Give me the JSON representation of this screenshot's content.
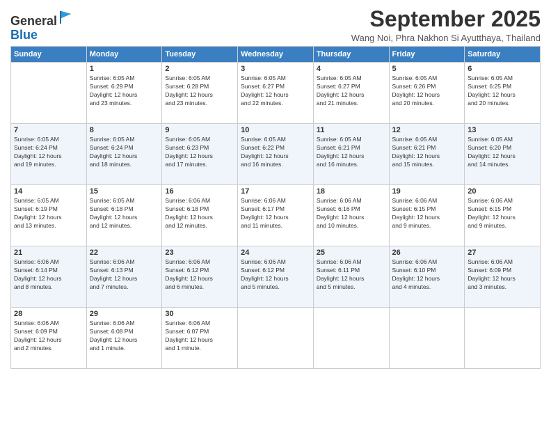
{
  "header": {
    "logo_line1": "General",
    "logo_line2": "Blue",
    "month_title": "September 2025",
    "location": "Wang Noi, Phra Nakhon Si Ayutthaya, Thailand"
  },
  "weekdays": [
    "Sunday",
    "Monday",
    "Tuesday",
    "Wednesday",
    "Thursday",
    "Friday",
    "Saturday"
  ],
  "weeks": [
    [
      {
        "day": "",
        "info": ""
      },
      {
        "day": "1",
        "info": "Sunrise: 6:05 AM\nSunset: 6:29 PM\nDaylight: 12 hours\nand 23 minutes."
      },
      {
        "day": "2",
        "info": "Sunrise: 6:05 AM\nSunset: 6:28 PM\nDaylight: 12 hours\nand 23 minutes."
      },
      {
        "day": "3",
        "info": "Sunrise: 6:05 AM\nSunset: 6:27 PM\nDaylight: 12 hours\nand 22 minutes."
      },
      {
        "day": "4",
        "info": "Sunrise: 6:05 AM\nSunset: 6:27 PM\nDaylight: 12 hours\nand 21 minutes."
      },
      {
        "day": "5",
        "info": "Sunrise: 6:05 AM\nSunset: 6:26 PM\nDaylight: 12 hours\nand 20 minutes."
      },
      {
        "day": "6",
        "info": "Sunrise: 6:05 AM\nSunset: 6:25 PM\nDaylight: 12 hours\nand 20 minutes."
      }
    ],
    [
      {
        "day": "7",
        "info": "Sunrise: 6:05 AM\nSunset: 6:24 PM\nDaylight: 12 hours\nand 19 minutes."
      },
      {
        "day": "8",
        "info": "Sunrise: 6:05 AM\nSunset: 6:24 PM\nDaylight: 12 hours\nand 18 minutes."
      },
      {
        "day": "9",
        "info": "Sunrise: 6:05 AM\nSunset: 6:23 PM\nDaylight: 12 hours\nand 17 minutes."
      },
      {
        "day": "10",
        "info": "Sunrise: 6:05 AM\nSunset: 6:22 PM\nDaylight: 12 hours\nand 16 minutes."
      },
      {
        "day": "11",
        "info": "Sunrise: 6:05 AM\nSunset: 6:21 PM\nDaylight: 12 hours\nand 16 minutes."
      },
      {
        "day": "12",
        "info": "Sunrise: 6:05 AM\nSunset: 6:21 PM\nDaylight: 12 hours\nand 15 minutes."
      },
      {
        "day": "13",
        "info": "Sunrise: 6:05 AM\nSunset: 6:20 PM\nDaylight: 12 hours\nand 14 minutes."
      }
    ],
    [
      {
        "day": "14",
        "info": "Sunrise: 6:05 AM\nSunset: 6:19 PM\nDaylight: 12 hours\nand 13 minutes."
      },
      {
        "day": "15",
        "info": "Sunrise: 6:05 AM\nSunset: 6:18 PM\nDaylight: 12 hours\nand 12 minutes."
      },
      {
        "day": "16",
        "info": "Sunrise: 6:06 AM\nSunset: 6:18 PM\nDaylight: 12 hours\nand 12 minutes."
      },
      {
        "day": "17",
        "info": "Sunrise: 6:06 AM\nSunset: 6:17 PM\nDaylight: 12 hours\nand 11 minutes."
      },
      {
        "day": "18",
        "info": "Sunrise: 6:06 AM\nSunset: 6:16 PM\nDaylight: 12 hours\nand 10 minutes."
      },
      {
        "day": "19",
        "info": "Sunrise: 6:06 AM\nSunset: 6:15 PM\nDaylight: 12 hours\nand 9 minutes."
      },
      {
        "day": "20",
        "info": "Sunrise: 6:06 AM\nSunset: 6:15 PM\nDaylight: 12 hours\nand 9 minutes."
      }
    ],
    [
      {
        "day": "21",
        "info": "Sunrise: 6:06 AM\nSunset: 6:14 PM\nDaylight: 12 hours\nand 8 minutes."
      },
      {
        "day": "22",
        "info": "Sunrise: 6:06 AM\nSunset: 6:13 PM\nDaylight: 12 hours\nand 7 minutes."
      },
      {
        "day": "23",
        "info": "Sunrise: 6:06 AM\nSunset: 6:12 PM\nDaylight: 12 hours\nand 6 minutes."
      },
      {
        "day": "24",
        "info": "Sunrise: 6:06 AM\nSunset: 6:12 PM\nDaylight: 12 hours\nand 5 minutes."
      },
      {
        "day": "25",
        "info": "Sunrise: 6:06 AM\nSunset: 6:11 PM\nDaylight: 12 hours\nand 5 minutes."
      },
      {
        "day": "26",
        "info": "Sunrise: 6:06 AM\nSunset: 6:10 PM\nDaylight: 12 hours\nand 4 minutes."
      },
      {
        "day": "27",
        "info": "Sunrise: 6:06 AM\nSunset: 6:09 PM\nDaylight: 12 hours\nand 3 minutes."
      }
    ],
    [
      {
        "day": "28",
        "info": "Sunrise: 6:06 AM\nSunset: 6:09 PM\nDaylight: 12 hours\nand 2 minutes."
      },
      {
        "day": "29",
        "info": "Sunrise: 6:06 AM\nSunset: 6:08 PM\nDaylight: 12 hours\nand 1 minute."
      },
      {
        "day": "30",
        "info": "Sunrise: 6:06 AM\nSunset: 6:07 PM\nDaylight: 12 hours\nand 1 minute."
      },
      {
        "day": "",
        "info": ""
      },
      {
        "day": "",
        "info": ""
      },
      {
        "day": "",
        "info": ""
      },
      {
        "day": "",
        "info": ""
      }
    ]
  ]
}
